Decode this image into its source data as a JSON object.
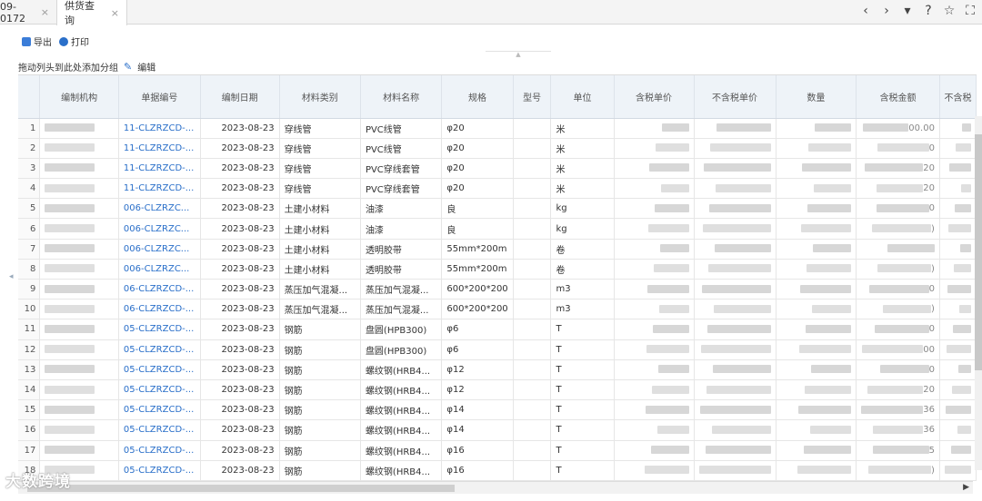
{
  "tabs": [
    {
      "label": "09-0172",
      "close": "×"
    },
    {
      "label": "供货查询",
      "close": "×"
    }
  ],
  "nav": {
    "prev": "‹",
    "next": "›",
    "dropdown": "▾",
    "help": "?",
    "star": "☆",
    "fullscreen": "⛶"
  },
  "toolbar": {
    "export_label": "导出",
    "print_label": "打印"
  },
  "groupbar": {
    "hint": "拖动列头到此处添加分组",
    "edit_label": "编辑"
  },
  "columns": [
    "",
    "编制机构",
    "单据编号",
    "编制日期",
    "材料类别",
    "材料名称",
    "规格",
    "型号",
    "单位",
    "含税单价",
    "不含税单价",
    "数量",
    "含税金额",
    "不含税"
  ],
  "rows": [
    {
      "idx": "1",
      "code": "11-CLZRZCD-...",
      "date": "2023-08-23",
      "category": "穿线管",
      "name": "PVC线管",
      "spec": "φ20",
      "model": "",
      "unit": "米",
      "amount_tail": "00.00"
    },
    {
      "idx": "2",
      "code": "11-CLZRZCD-...",
      "date": "2023-08-23",
      "category": "穿线管",
      "name": "PVC线管",
      "spec": "φ20",
      "model": "",
      "unit": "米",
      "amount_tail": "0"
    },
    {
      "idx": "3",
      "code": "11-CLZRZCD-...",
      "date": "2023-08-23",
      "category": "穿线管",
      "name": "PVC穿线套管",
      "spec": "φ20",
      "model": "",
      "unit": "米",
      "amount_tail": "20"
    },
    {
      "idx": "4",
      "code": "11-CLZRZCD-...",
      "date": "2023-08-23",
      "category": "穿线管",
      "name": "PVC穿线套管",
      "spec": "φ20",
      "model": "",
      "unit": "米",
      "amount_tail": "20"
    },
    {
      "idx": "5",
      "code": "006-CLZRZC...",
      "date": "2023-08-23",
      "category": "土建小材料",
      "name": "油漆",
      "spec": "良",
      "model": "",
      "unit": "kg",
      "amount_tail": "0"
    },
    {
      "idx": "6",
      "code": "006-CLZRZC...",
      "date": "2023-08-23",
      "category": "土建小材料",
      "name": "油漆",
      "spec": "良",
      "model": "",
      "unit": "kg",
      "amount_tail": ")"
    },
    {
      "idx": "7",
      "code": "006-CLZRZC...",
      "date": "2023-08-23",
      "category": "土建小材料",
      "name": "透明胶带",
      "spec": "55mm*200m",
      "model": "",
      "unit": "卷",
      "amount_tail": ""
    },
    {
      "idx": "8",
      "code": "006-CLZRZC...",
      "date": "2023-08-23",
      "category": "土建小材料",
      "name": "透明胶带",
      "spec": "55mm*200m",
      "model": "",
      "unit": "卷",
      "amount_tail": ")"
    },
    {
      "idx": "9",
      "code": "06-CLZRZCD-...",
      "date": "2023-08-23",
      "category": "蒸压加气混凝...",
      "name": "蒸压加气混凝...",
      "spec": "600*200*200",
      "model": "",
      "unit": "m3",
      "amount_tail": "0"
    },
    {
      "idx": "10",
      "code": "06-CLZRZCD-...",
      "date": "2023-08-23",
      "category": "蒸压加气混凝...",
      "name": "蒸压加气混凝...",
      "spec": "600*200*200",
      "model": "",
      "unit": "m3",
      "amount_tail": ")"
    },
    {
      "idx": "11",
      "code": "05-CLZRZCD-...",
      "date": "2023-08-23",
      "category": "钢筋",
      "name": "盘圆(HPB300)",
      "spec": "φ6",
      "model": "",
      "unit": "T",
      "amount_tail": "0"
    },
    {
      "idx": "12",
      "code": "05-CLZRZCD-...",
      "date": "2023-08-23",
      "category": "钢筋",
      "name": "盘圆(HPB300)",
      "spec": "φ6",
      "model": "",
      "unit": "T",
      "amount_tail": "00"
    },
    {
      "idx": "13",
      "code": "05-CLZRZCD-...",
      "date": "2023-08-23",
      "category": "钢筋",
      "name": "螺纹钢(HRB4...",
      "spec": "φ12",
      "model": "",
      "unit": "T",
      "amount_tail": "0"
    },
    {
      "idx": "14",
      "code": "05-CLZRZCD-...",
      "date": "2023-08-23",
      "category": "钢筋",
      "name": "螺纹钢(HRB4...",
      "spec": "φ12",
      "model": "",
      "unit": "T",
      "amount_tail": "20"
    },
    {
      "idx": "15",
      "code": "05-CLZRZCD-...",
      "date": "2023-08-23",
      "category": "钢筋",
      "name": "螺纹钢(HRB4...",
      "spec": "φ14",
      "model": "",
      "unit": "T",
      "amount_tail": "36"
    },
    {
      "idx": "16",
      "code": "05-CLZRZCD-...",
      "date": "2023-08-23",
      "category": "钢筋",
      "name": "螺纹钢(HRB4...",
      "spec": "φ14",
      "model": "",
      "unit": "T",
      "amount_tail": "36"
    },
    {
      "idx": "17",
      "code": "05-CLZRZCD-...",
      "date": "2023-08-23",
      "category": "钢筋",
      "name": "螺纹钢(HRB4...",
      "spec": "φ16",
      "model": "",
      "unit": "T",
      "amount_tail": "5"
    },
    {
      "idx": "18",
      "code": "05-CLZRZCD-...",
      "date": "2023-08-23",
      "category": "钢筋",
      "name": "螺纹钢(HRB4...",
      "spec": "φ16",
      "model": "",
      "unit": "T",
      "amount_tail": ")"
    }
  ],
  "watermark": "大数跨境",
  "colors": {
    "link": "#2a6fc9",
    "header_bg": "#eef3f8"
  }
}
